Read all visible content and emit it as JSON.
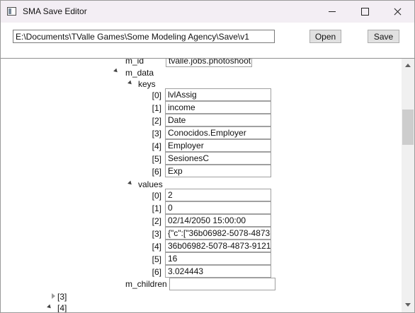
{
  "window": {
    "title": "SMA Save Editor"
  },
  "toolbar": {
    "path_value": "E:\\Documents\\TValle Games\\Some Modeling Agency\\Save\\v1",
    "open_label": "Open",
    "save_label": "Save"
  },
  "tree": {
    "m_id": {
      "label": "m_id",
      "value": "tvalle.jobs.photoshoot"
    },
    "m_data": "m_data",
    "keys": {
      "label": "keys",
      "items": [
        {
          "index": "[0]",
          "value": "lvlAssig"
        },
        {
          "index": "[1]",
          "value": "income"
        },
        {
          "index": "[2]",
          "value": "Date"
        },
        {
          "index": "[3]",
          "value": "Conocidos.Employer"
        },
        {
          "index": "[4]",
          "value": "Employer"
        },
        {
          "index": "[5]",
          "value": "SesionesC"
        },
        {
          "index": "[6]",
          "value": "Exp"
        }
      ]
    },
    "values": {
      "label": "values",
      "items": [
        {
          "index": "[0]",
          "value": "2"
        },
        {
          "index": "[1]",
          "value": "0"
        },
        {
          "index": "[2]",
          "value": "02/14/2050 15:00:00"
        },
        {
          "index": "[3]",
          "value": "{\"c\":[\"36b06982-5078-4873-"
        },
        {
          "index": "[4]",
          "value": "36b06982-5078-4873-9121-"
        },
        {
          "index": "[5]",
          "value": "16"
        },
        {
          "index": "[6]",
          "value": "3.024443"
        }
      ]
    },
    "m_children": {
      "label": "m_children",
      "value": ""
    },
    "node3": "[3]",
    "node4": "[4]"
  }
}
